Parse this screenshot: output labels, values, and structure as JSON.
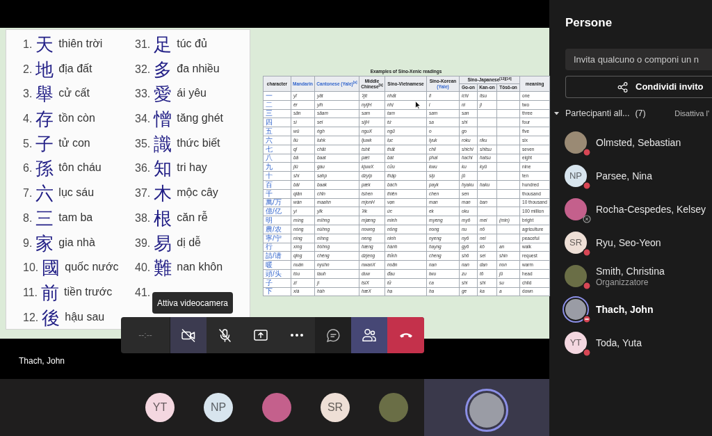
{
  "stage": {
    "word_list": {
      "columns": [
        [
          {
            "number": "1.",
            "character": "天",
            "reading": "thiên trời"
          },
          {
            "number": "2.",
            "character": "地",
            "reading": "địa đất"
          },
          {
            "number": "3.",
            "character": "舉",
            "reading": "cử cất"
          },
          {
            "number": "4.",
            "character": "存",
            "reading": "tồn còn"
          },
          {
            "number": "5.",
            "character": "子",
            "reading": "tử con"
          },
          {
            "number": "6.",
            "character": "孫",
            "reading": "tôn cháu"
          },
          {
            "number": "7.",
            "character": "六",
            "reading": "lục sáu"
          },
          {
            "number": "8.",
            "character": "三",
            "reading": "tam ba"
          },
          {
            "number": "9.",
            "character": "家",
            "reading": "gia nhà"
          },
          {
            "number": "10.",
            "character": "國",
            "reading": "quốc nước"
          },
          {
            "number": "11.",
            "character": "前",
            "reading": "tiền trước"
          },
          {
            "number": "12.",
            "character": "後",
            "reading": "hậu sau"
          }
        ],
        [
          {
            "number": "31.",
            "character": "足",
            "reading": "túc đủ"
          },
          {
            "number": "32.",
            "character": "多",
            "reading": "đa nhiều"
          },
          {
            "number": "33.",
            "character": "愛",
            "reading": "ái yêu"
          },
          {
            "number": "34.",
            "character": "憎",
            "reading": "tăng ghét"
          },
          {
            "number": "35.",
            "character": "識",
            "reading": "thức biết"
          },
          {
            "number": "36.",
            "character": "知",
            "reading": "tri hay"
          },
          {
            "number": "37.",
            "character": "木",
            "reading": "mộc cây"
          },
          {
            "number": "38.",
            "character": "根",
            "reading": "căn rễ"
          },
          {
            "number": "39.",
            "character": "易",
            "reading": "dị dễ"
          },
          {
            "number": "40.",
            "character": "難",
            "reading": "nan khôn"
          },
          {
            "number": "41."
          }
        ]
      ]
    },
    "readings_table": {
      "caption": "Examples of Sino-Xenic readings",
      "header": [
        {
          "text": "character",
          "link": false
        },
        {
          "text": "Mandarin",
          "link": true
        },
        {
          "text": "Cantonese (Yale)$^{[a]}$",
          "link": true
        },
        {
          "text": "Middle Chinese$^{[b]}$",
          "link": false
        },
        {
          "text": "Sino-Vietnamese",
          "link": false
        },
        {
          "text": "Sino-Korean",
          "link": false,
          "sub_link": "(Yale)"
        },
        {
          "text": "Sino-Japanese$^{[13][14]}$",
          "link": false,
          "subcolumns": [
            "Go-on",
            "Kan-on",
            "Tōsō-on"
          ]
        },
        {
          "text": "meaning",
          "link": false
        }
      ],
      "rows": [
        [
          "一",
          "yī",
          "yāt",
          "ʔjit",
          "nhất",
          "il",
          "ichi",
          "itsu",
          null,
          "one"
        ],
        [
          "二",
          "èr",
          "yih",
          "nyijH",
          "nhị",
          "i",
          "ni",
          "ji",
          null,
          "two"
        ],
        [
          "三",
          "sān",
          "sāam",
          "sam",
          "tam",
          "sam",
          "san",
          null,
          null,
          "three"
        ],
        [
          "四",
          "sì",
          "sei",
          "sijH",
          "tứ",
          "sa",
          "shi",
          null,
          null,
          "four"
        ],
        [
          "五",
          "wǔ",
          "ńgh",
          "nguX",
          "ngũ",
          "o",
          "go",
          null,
          null,
          "five"
        ],
        [
          "六",
          "liù",
          "luhk",
          "ljuwk",
          "lục",
          "lyuk",
          "roku",
          "riku",
          null,
          "six"
        ],
        [
          "七",
          "qī",
          "chāt",
          "tshit",
          "thất",
          "chil",
          "shichi",
          "shitsu",
          null,
          "seven"
        ],
        [
          "八",
          "bā",
          "baat",
          "pæt",
          "bát",
          "phal",
          "hachi",
          "hatsu",
          null,
          "eight"
        ],
        [
          "九",
          "jiǔ",
          "gáu",
          "kjuwX",
          "cửu",
          "kwu",
          "ku",
          "kyū",
          null,
          "nine"
        ],
        [
          "十",
          "shí",
          "sahp",
          "dzyip",
          "thập",
          "sip",
          "jū",
          null,
          null,
          "ten"
        ],
        [
          "百",
          "bǎi",
          "baak",
          "pæk",
          "bách",
          "payk",
          "hyaku",
          "haku",
          null,
          "hundred"
        ],
        [
          "千",
          "qiān",
          "chīn",
          "tshen",
          "thiên",
          "chen",
          "sen",
          null,
          null,
          "thousand"
        ],
        [
          "萬/万",
          "wàn",
          "maahn",
          "mjonH",
          "vạn",
          "man",
          "man",
          "ban",
          null,
          "10 thousand"
        ],
        [
          "億/亿",
          "yì",
          "yīk",
          "ʔik",
          "ức",
          "ek",
          "oku",
          null,
          null,
          "100 million"
        ],
        [
          "明",
          "míng",
          "mìhng",
          "mjæng",
          "minh",
          "myeng",
          "myō",
          "mei",
          "(min)",
          "bright"
        ],
        [
          "農/农",
          "nóng",
          "nùhng",
          "nowng",
          "nông",
          "nong",
          "nu",
          "nō",
          null,
          "agriculture"
        ],
        [
          "寧/宁",
          "níng",
          "nìhng",
          "neng",
          "ninh",
          "nyeng",
          "nyō",
          "nei",
          null,
          "peaceful"
        ],
        [
          "行",
          "xíng",
          "hòhng",
          "hæng",
          "hành",
          "hayng",
          "gyō",
          "kō",
          "an",
          "walk"
        ],
        [
          "請/请",
          "qǐng",
          "chéng",
          "dzjeng",
          "thỉnh",
          "cheng",
          "shō",
          "sei",
          "shin",
          "request"
        ],
        [
          "暖",
          "nuǎn",
          "nyúhn",
          "nwanX",
          "noãn",
          "nan",
          "nan",
          "dan",
          "non",
          "warm"
        ],
        [
          "頭/头",
          "tóu",
          "tàuh",
          "duw",
          "đầu",
          "twu",
          "zu",
          "tō",
          "jū",
          "head"
        ],
        [
          "子",
          "zǐ",
          "jí",
          "tsiX",
          "tử",
          "ca",
          "shi",
          "shi",
          "su",
          "child"
        ],
        [
          "下",
          "xià",
          "hàh",
          "hæX",
          "hạ",
          "ha",
          "ge",
          "ka",
          "a",
          "down"
        ]
      ]
    },
    "presenter": "Thach, John"
  },
  "tooltip": "Attiva videocamera",
  "call_controls": {
    "timer": "--:--",
    "buttons": [
      {
        "kind": "camera",
        "on": false,
        "hovered": true
      },
      {
        "kind": "mic",
        "on": false,
        "hovered": false
      },
      {
        "kind": "share",
        "on": false,
        "hovered": false
      },
      {
        "kind": "more",
        "on": false,
        "hovered": false
      },
      {
        "kind": "chat",
        "on": false,
        "hovered": false
      },
      {
        "kind": "people",
        "on": true,
        "hovered": false
      },
      {
        "kind": "hangup",
        "on": false,
        "hovered": false
      }
    ]
  },
  "gallery": {
    "avatars": [
      {
        "kind": "initials",
        "initials": "YT",
        "color": "#f4d7e0"
      },
      {
        "kind": "initials",
        "initials": "NP",
        "color": "#d8e5ee"
      },
      {
        "kind": "photo",
        "color": "#c4608c"
      },
      {
        "kind": "initials",
        "initials": "SR",
        "color": "#eedfd6"
      },
      {
        "kind": "photo",
        "color": "#6a6e46"
      }
    ],
    "spotlight": {
      "avatar": {
        "kind": "photo",
        "color": "#9a9ca5"
      },
      "speaking": true
    }
  },
  "people_panel": {
    "title": "Persone",
    "invite_field": {
      "placeholder": "Invita qualcuno o componi un n"
    },
    "share_button": "Condividi invito",
    "section": {
      "label": "Partecipanti all...",
      "count": "(7)",
      "expanded": true,
      "action": "Disattiva l'"
    },
    "participants": [
      {
        "name": "Olmsted, Sebastian",
        "avatar": {
          "kind": "photo",
          "color": "#9a8a74"
        },
        "presence": {
          "kind": "busy"
        },
        "speaking": false
      },
      {
        "name": "Parsee, Nina",
        "avatar": {
          "kind": "initials",
          "initials": "NP",
          "color": "#d8e5ee"
        },
        "presence": {
          "kind": "busy"
        },
        "speaking": false
      },
      {
        "name": "Rocha-Cespedes, Kelsey",
        "avatar": {
          "kind": "photo",
          "color": "#c4608c"
        },
        "presence": {
          "kind": "offline"
        },
        "speaking": false
      },
      {
        "name": "Ryu, Seo-Yeon",
        "avatar": {
          "kind": "initials",
          "initials": "SR",
          "color": "#eedfd6"
        },
        "presence": {
          "kind": "busy"
        },
        "speaking": false
      },
      {
        "name": "Smith, Christina",
        "role": "Organizzatore",
        "avatar": {
          "kind": "photo",
          "color": "#6a6e46"
        },
        "presence": {
          "kind": "busy"
        },
        "speaking": false
      },
      {
        "name": "Thach, John",
        "avatar": {
          "kind": "photo",
          "color": "#9a9ca5"
        },
        "presence": {
          "kind": "dnd"
        },
        "speaking": true
      },
      {
        "name": "Toda, Yuta",
        "avatar": {
          "kind": "initials",
          "initials": "YT",
          "color": "#f4d7e0"
        },
        "presence": {
          "kind": "busy"
        },
        "speaking": false
      }
    ]
  }
}
